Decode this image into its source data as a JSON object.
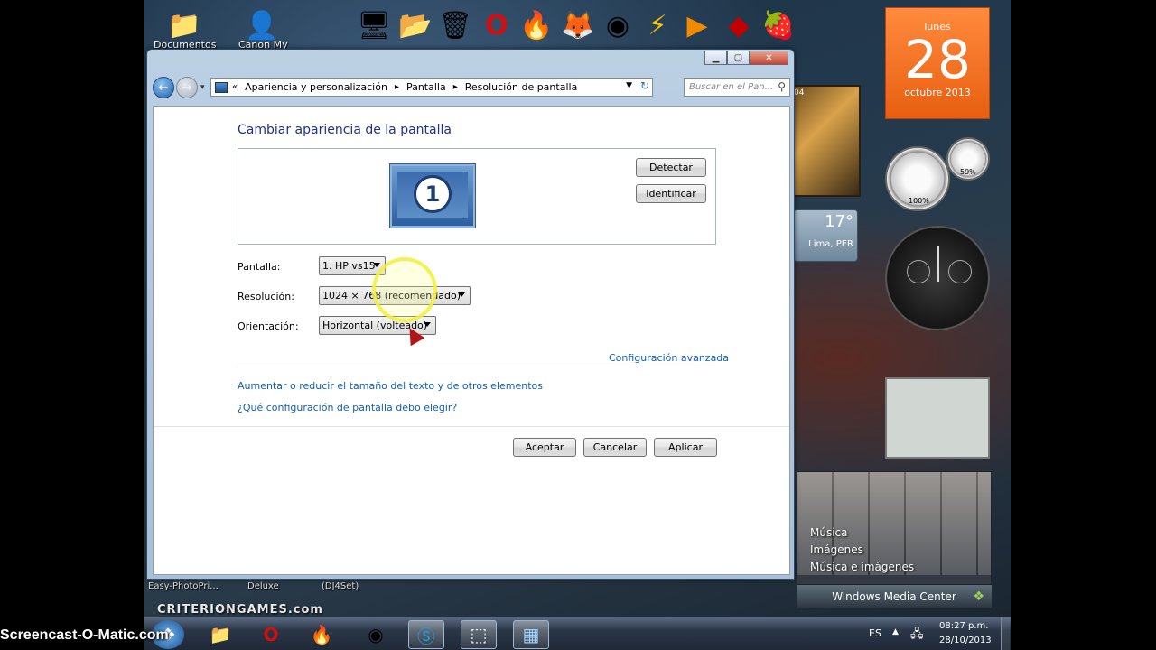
{
  "desktop": {
    "icons": [
      {
        "label": "Documentos",
        "icon": "folder-icon"
      },
      {
        "label": "Canon My",
        "icon": "user-icon"
      }
    ],
    "quick_icons": [
      "computer-icon",
      "folder-icon",
      "recycle-bin-icon",
      "opera-icon",
      "browser-icon",
      "firefox-icon",
      "chrome-icon",
      "winamp-icon",
      "media-player-icon",
      "app-icon",
      "fl-studio-icon"
    ],
    "bottom_labels": [
      "Easy-PhotoPri...",
      "Deluxe",
      "(DJ4Set)"
    ],
    "banner": "CRITERIONGAMES.com"
  },
  "window": {
    "breadcrumb": [
      "Apariencia y personalización",
      "Pantalla",
      "Resolución de pantalla"
    ],
    "search_placeholder": "Buscar en el Pan...",
    "heading": "Cambiar apariencia de la pantalla",
    "detect_label": "Detectar",
    "identify_label": "Identificar",
    "monitor_number": "1",
    "pantalla_label": "Pantalla:",
    "pantalla_value": "1. HP vs15",
    "resolucion_label": "Resolución:",
    "resolucion_value": "1024 × 768 (recomendado)",
    "orientacion_label": "Orientación:",
    "orientacion_value": "Horizontal (volteado)",
    "advanced_link": "Configuración avanzada",
    "link_text_size": "Aumentar o reducir el tamaño del texto y de otros elementos",
    "link_which_settings": "¿Qué configuración de pantalla debo elegir?",
    "accept": "Aceptar",
    "cancel": "Cancelar",
    "apply": "Aplicar"
  },
  "gadgets": {
    "calendar": {
      "day": "lunes",
      "date": "28",
      "month": "octubre 2013"
    },
    "meter": {
      "cpu": "100%",
      "mem": "59%"
    },
    "weather": {
      "temp": "17°",
      "city": "Lima, PER"
    },
    "media_center": {
      "items": [
        "Música",
        "Imágenes",
        "Música e imágenes"
      ],
      "title": "Windows Media Center"
    },
    "puzzle_time": "04"
  },
  "taskbar": {
    "language": "ES",
    "time": "08:27 p.m.",
    "date": "28/10/2013"
  },
  "watermark": "Screencast-O-Matic.com"
}
